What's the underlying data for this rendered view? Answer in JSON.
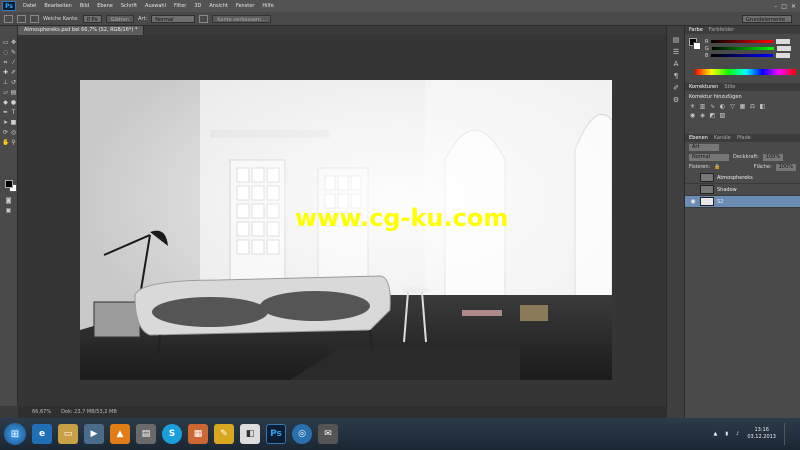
{
  "app": {
    "logo": "Ps"
  },
  "menu": {
    "items": [
      "Datei",
      "Bearbeiten",
      "Bild",
      "Ebene",
      "Schrift",
      "Auswahl",
      "Filter",
      "3D",
      "Ansicht",
      "Fenster",
      "Hilfe"
    ]
  },
  "options": {
    "feather_label": "Weiche Kante:",
    "feather_value": "0 Px",
    "antialias_label": "Glätten",
    "style_label": "Art:",
    "style_value": "Normal",
    "refine_label": "Kante verbessern...",
    "workspace": "Grundelemente"
  },
  "document": {
    "tab_title": "Atmosphereks.psd bei 66,7% (S2, RGB/16*) *"
  },
  "canvas": {
    "watermark": "www.cg-ku.com"
  },
  "status": {
    "zoom": "66,67%",
    "doc_size": "Dok: 23,7 MB/53,2 MB"
  },
  "panels": {
    "color_tabs": [
      "Farbe",
      "Farbfelder"
    ],
    "color": {
      "r": "R",
      "g": "G",
      "b": "B"
    },
    "adjust_tabs": [
      "Korrekturen",
      "Stile"
    ],
    "adjust_title": "Korrektur hinzufügen",
    "layer_tabs": [
      "Ebenen",
      "Kanäle",
      "Pfade"
    ],
    "kind_value": "Art",
    "blend_value": "Normal",
    "opacity_label": "Deckkraft:",
    "opacity_value": "100%",
    "lock_label": "Fixieren:",
    "fill_label": "Fläche:",
    "fill_value": "100%",
    "layers": [
      {
        "name": "Atmosphereks",
        "visible": false
      },
      {
        "name": "Shadow",
        "visible": false
      },
      {
        "name": "S2",
        "visible": true
      }
    ]
  },
  "taskbar": {
    "time": "13:16",
    "date": "03.12.2013"
  },
  "icons": {
    "windows_start": "windows-start-icon",
    "ie": "ie-icon",
    "photoshop": "photoshop-icon"
  }
}
